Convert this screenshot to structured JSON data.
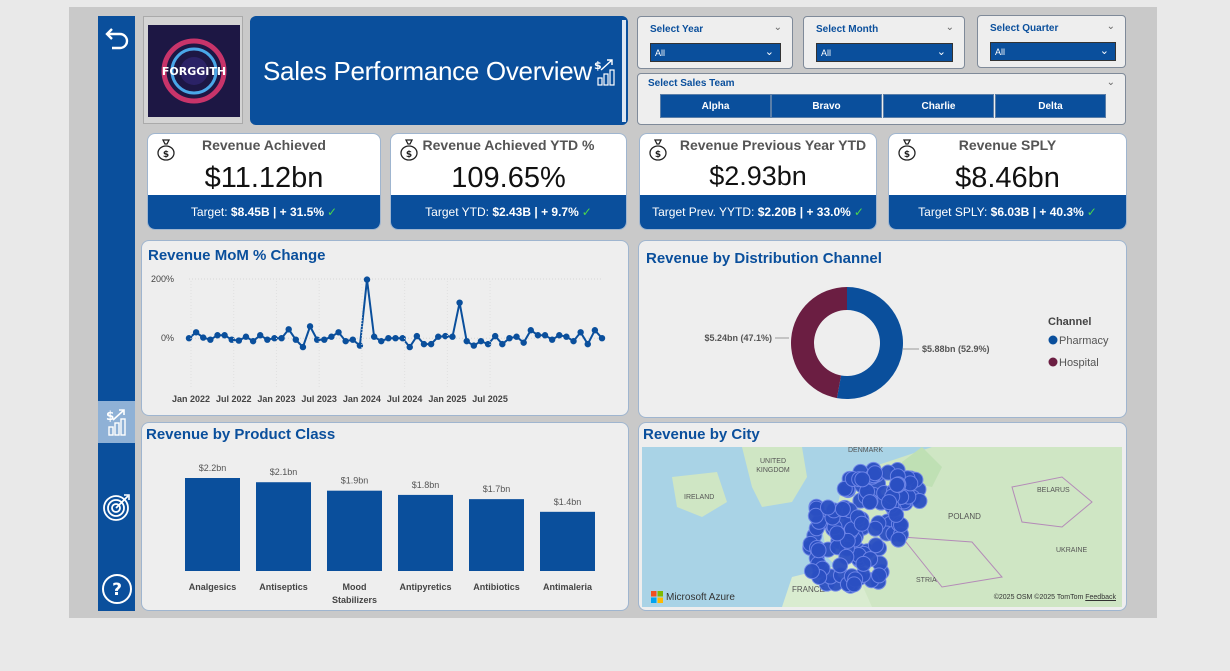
{
  "rail": {
    "items": [
      {
        "name": "back-icon"
      },
      {
        "name": "sales-chart-icon",
        "active": true
      },
      {
        "name": "target-icon"
      },
      {
        "name": "help-icon"
      }
    ]
  },
  "header": {
    "logo_text": "FORGGITH",
    "title": "Sales Performance Overview"
  },
  "slicers": {
    "year": {
      "label": "Select Year",
      "value": "All"
    },
    "month": {
      "label": "Select Month",
      "value": "All"
    },
    "quarter": {
      "label": "Select Quarter",
      "value": "All"
    },
    "team": {
      "label": "Select Sales Team",
      "options": [
        "Alpha",
        "Bravo",
        "Charlie",
        "Delta"
      ]
    }
  },
  "kpis": [
    {
      "title": "Revenue Achieved",
      "value": "$11.12bn",
      "foot_label": "Target:",
      "foot_value": "$8.45B",
      "foot_delta": "| + 31.5%"
    },
    {
      "title": "Revenue Achieved YTD %",
      "value": "109.65%",
      "foot_label": "Target YTD:",
      "foot_value": "$2.43B",
      "foot_delta": "| + 9.7%"
    },
    {
      "title": "Revenue Previous Year YTD",
      "value": "$2.93bn",
      "foot_label": "Target Prev. YYTD:",
      "foot_value": "$2.20B",
      "foot_delta": "| + 33.0%"
    },
    {
      "title": "Revenue SPLY",
      "value": "$8.46bn",
      "foot_label": "Target SPLY:",
      "foot_value": "$6.03B",
      "foot_delta": "| + 40.3%"
    }
  ],
  "panels": {
    "mom_title": "Revenue MoM % Change",
    "channel_title": "Revenue by Distribution Channel",
    "product_title": "Revenue by Product Class",
    "city_title": "Revenue by City"
  },
  "chart_data": [
    {
      "type": "line",
      "title": "Revenue MoM % Change",
      "y_ticks": [
        "200%",
        "0%"
      ],
      "ylim": [
        -50,
        200
      ],
      "x_ticks": [
        "Jan 2022",
        "Jul 2022",
        "Jan 2023",
        "Jul 2023",
        "Jan 2024",
        "Jul 2024",
        "Jan 2025",
        "Jul 2025"
      ],
      "series": [
        {
          "values": [
            0,
            20,
            2,
            -5,
            10,
            10,
            -5,
            -8,
            5,
            -10,
            10,
            -5,
            0,
            0,
            30,
            -5,
            -30,
            40,
            -5,
            -5,
            5,
            20,
            -10,
            -5,
            -25,
            198,
            5,
            -10,
            0,
            0,
            0,
            -30,
            7,
            -20,
            -20,
            5,
            7,
            5,
            120,
            -10,
            -25,
            -10,
            -20,
            7,
            -20,
            0,
            5,
            -15,
            27,
            10,
            10,
            -5,
            10,
            5,
            -10,
            20,
            -20,
            27,
            0
          ]
        }
      ],
      "grid": true
    },
    {
      "type": "pie",
      "title": "Revenue by Distribution Channel",
      "legend_title": "Channel",
      "legend_position": "right",
      "slices": [
        {
          "label": "Pharmacy",
          "value": 5.88,
          "text": "$5.88bn (52.9%)",
          "color": "#0a4f9c"
        },
        {
          "label": "Hospital",
          "value": 5.24,
          "text": "$5.24bn (47.1%)",
          "color": "#6b1e42"
        }
      ]
    },
    {
      "type": "bar",
      "title": "Revenue by Product Class",
      "categories": [
        "Analgesics",
        "Antiseptics",
        "Mood Stabilizers",
        "Antipyretics",
        "Antibiotics",
        "Antimaleria"
      ],
      "values": [
        2.2,
        2.1,
        1.9,
        1.8,
        1.7,
        1.4
      ],
      "value_labels": [
        "$2.2bn",
        "$2.1bn",
        "$1.9bn",
        "$1.8bn",
        "$1.7bn",
        "$1.4bn"
      ],
      "ylim": [
        0,
        2.2
      ]
    }
  ],
  "map": {
    "labels": {
      "denmark": "DENMARK",
      "uk": "UNITED KINGDOM",
      "ireland": "IRELAND",
      "belarus": "BELARUS",
      "poland": "POLAND",
      "ukraine": "UKRAINE",
      "france": "FRANCE",
      "austria": "STRIA"
    },
    "brand": "Microsoft Azure",
    "attribution": "©2025 OSM ©2025 TomTom",
    "feedback": "Feedback"
  },
  "colors": {
    "primary": "#0a4f9c",
    "secondary": "#6b1e42",
    "check": "#4cd64c"
  }
}
